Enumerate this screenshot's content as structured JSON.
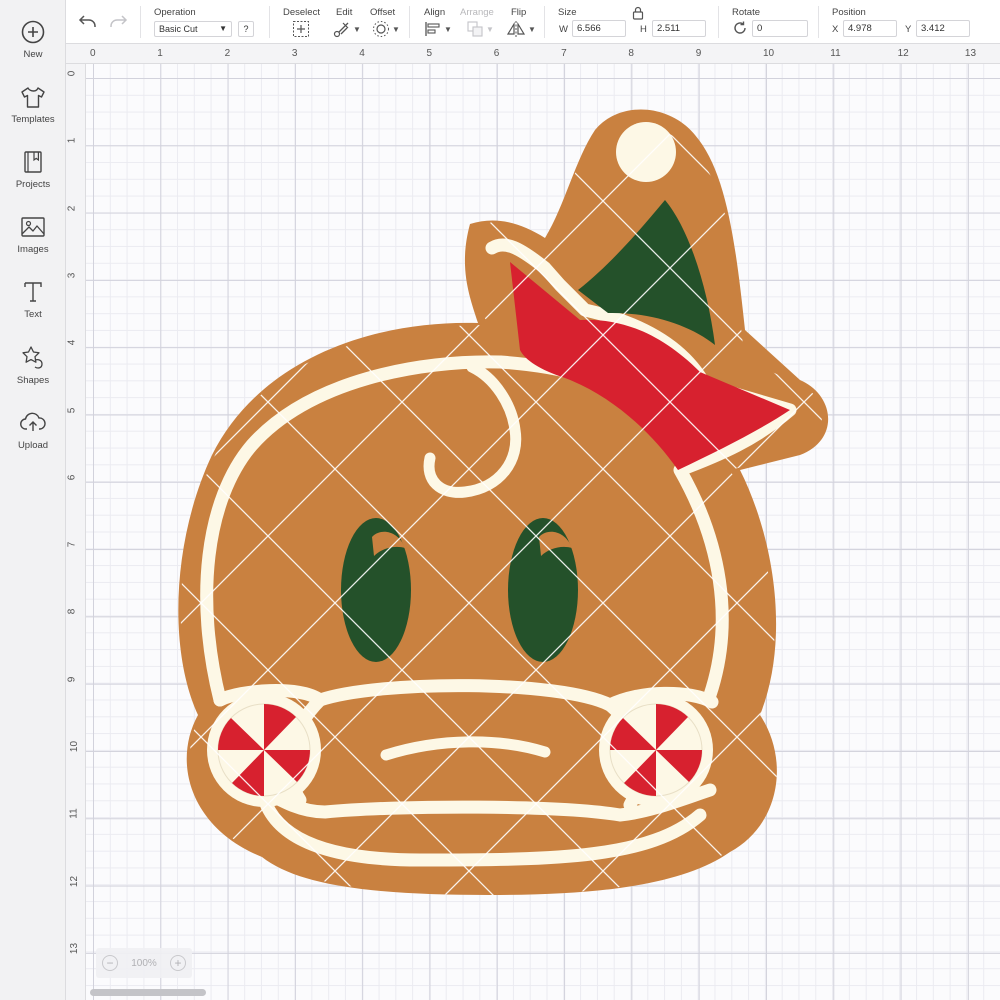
{
  "sidebar": {
    "items": [
      {
        "label": "New",
        "icon": "plus-circle-icon"
      },
      {
        "label": "Templates",
        "icon": "tshirt-icon"
      },
      {
        "label": "Projects",
        "icon": "bookmark-book-icon"
      },
      {
        "label": "Images",
        "icon": "image-icon"
      },
      {
        "label": "Text",
        "icon": "text-t-icon"
      },
      {
        "label": "Shapes",
        "icon": "shapes-icon"
      },
      {
        "label": "Upload",
        "icon": "cloud-upload-icon"
      }
    ]
  },
  "toolbar": {
    "operation_label": "Operation",
    "operation_value": "Basic Cut",
    "help": "?",
    "deselect_label": "Deselect",
    "edit_label": "Edit",
    "offset_label": "Offset",
    "align_label": "Align",
    "arrange_label": "Arrange",
    "flip_label": "Flip",
    "size_label": "Size",
    "w_label": "W",
    "w_value": "6.566",
    "h_label": "H",
    "h_value": "2.511",
    "rotate_label": "Rotate",
    "rotate_value": "0",
    "position_label": "Position",
    "x_label": "X",
    "x_value": "4.978",
    "y_label": "Y",
    "y_value": "3.412"
  },
  "ruler": {
    "top": [
      "0",
      "1",
      "2",
      "3",
      "4",
      "5",
      "6",
      "7",
      "8",
      "9",
      "10",
      "11",
      "12",
      "13"
    ],
    "left": [
      "0",
      "1",
      "2",
      "3",
      "4",
      "5",
      "6",
      "7",
      "8",
      "9",
      "10",
      "11",
      "12",
      "13"
    ]
  },
  "zoom": {
    "minus": "−",
    "value": "100%",
    "plus": "+"
  },
  "colors": {
    "gingerbread": "#c98140",
    "icing": "#fdf8e6",
    "hat_red": "#d7212f",
    "hat_green": "#24512a",
    "eye_green": "#24512a",
    "grid_major": "#d2d2dc",
    "grid_minor": "#ebebf1"
  }
}
